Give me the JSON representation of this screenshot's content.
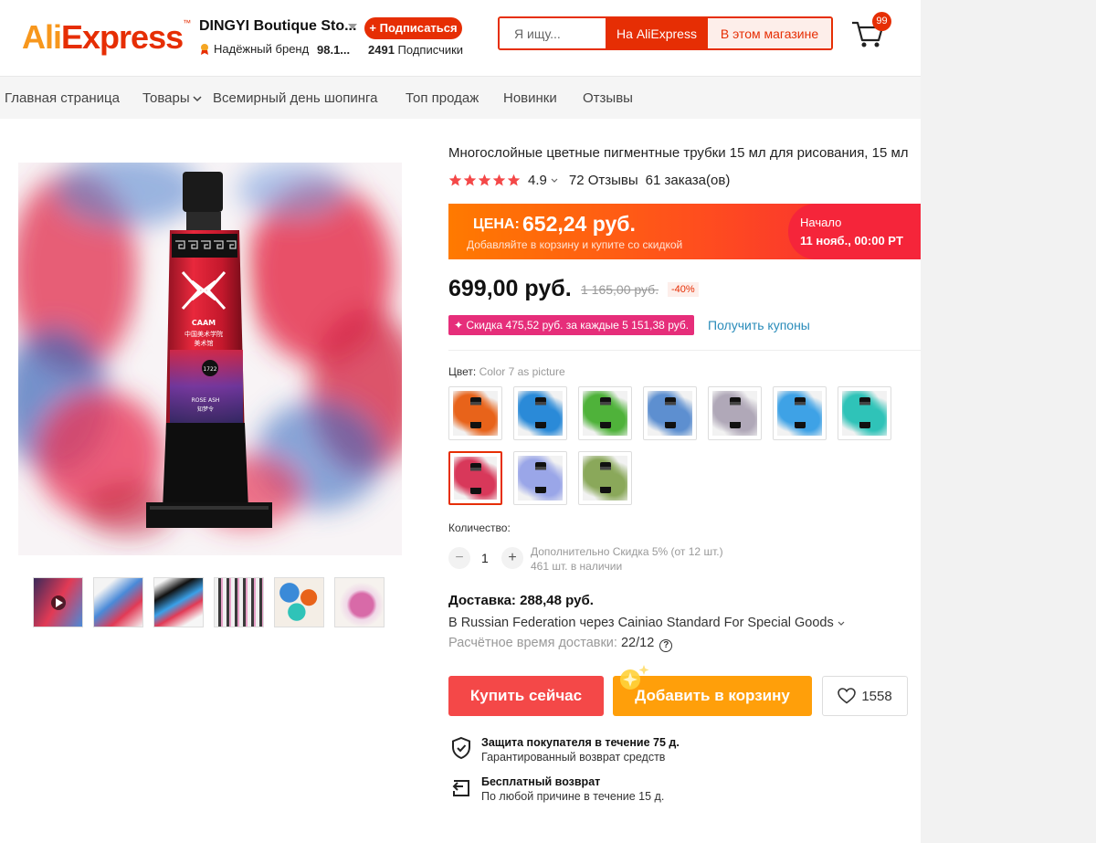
{
  "header": {
    "logo_text": "AliExpress",
    "store_name": "DINGYI Boutique Sto...",
    "brand_badge": "Надёжный бренд",
    "brand_rating": "98.1...",
    "subscribe_label": "+ Подписаться",
    "subscribers_count": "2491",
    "subscribers_label": "Подписчики",
    "search_placeholder": "Я ищу...",
    "search_aliexpress": "На AliExpress",
    "search_store": "В этом магазине",
    "cart_count": "99"
  },
  "nav": {
    "items": [
      "Главная страница",
      "Товары",
      "Всемирный день шопинга",
      "Топ продаж",
      "Новинки",
      "Отзывы"
    ]
  },
  "product": {
    "title": "Многослойные цветные пигментные трубки 15 мл для рисования, 15 мл",
    "rating": "4.9",
    "reviews": "72 Отзывы",
    "orders": "61 заказа(ов)",
    "promo_label": "ЦЕНА:",
    "promo_price": "652,24 руб.",
    "promo_sub": "Добавляйте в корзину и купите со скидкой",
    "promo_start_label": "Начало",
    "promo_start_date": "11 нояб., 00:00 PT",
    "price": "699,00 руб.",
    "old_price": "1 165,00 руб.",
    "discount": "-40%",
    "coupon": "✦ Скидка 475,52 руб. за каждые 5 151,38 руб.",
    "get_coupons": "Получить купоны",
    "color_label": "Цвет:",
    "color_value": "Color 7 as picture",
    "swatch_colors": [
      "#e8631a",
      "#2a8ad8",
      "#4fb23a",
      "#5d8fd0",
      "#b0a8b8",
      "#3ea2e6",
      "#2fc3b8",
      "#d8385a",
      "#9aa6e8",
      "#8aa85a"
    ],
    "selected_swatch": 7,
    "quantity_label": "Количество:",
    "quantity": "1",
    "qty_note": "Дополнительно Скидка 5% (от 12 шт.)",
    "stock": "461 шт. в наличии",
    "shipping_title": "Доставка: 288,48 руб.",
    "shipping_via": "В Russian Federation через Cainiao Standard For Special Goods",
    "eta_label": "Расчётное время доставки:",
    "eta_value": "22/12",
    "buy_now": "Купить сейчас",
    "add_to_cart": "Добавить в корзину",
    "wishlist_count": "1558",
    "protection_title": "Защита покупателя в течение 75 д.",
    "protection_sub": "Гарантированный возврат средств",
    "return_title": "Бесплатный возврат",
    "return_sub": "По любой причине в течение 15 д."
  },
  "gallery": {
    "tube_brand": "CAAM",
    "tube_cn_1": "中国美术学院",
    "tube_cn_2": "美术馆",
    "tube_number": "1722",
    "tube_color_name": "ROSE ASH",
    "tube_color_cn": "知梦令",
    "thumb_count": 6
  }
}
